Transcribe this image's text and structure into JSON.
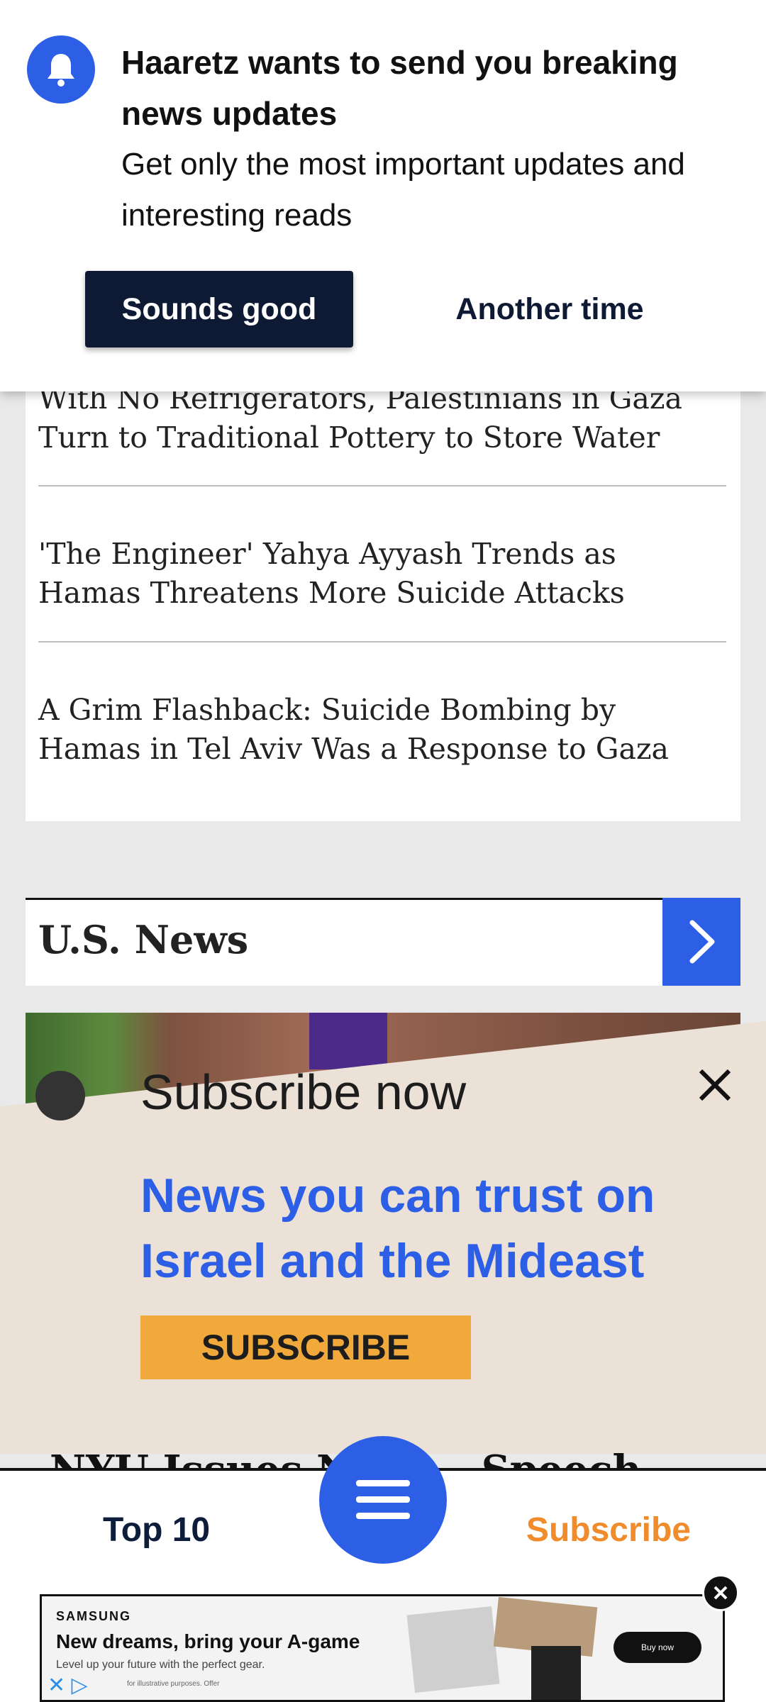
{
  "notification_prompt": {
    "title": "Haaretz wants to send you breaking news updates",
    "body": "Get only the most important updates and interesting reads",
    "accept_label": "Sounds good",
    "decline_label": "Another time",
    "icon": "bell-icon"
  },
  "articles": [
    {
      "title": "With No Refrigerators, Palestinians in Gaza Turn to Traditional Pottery to Store Water"
    },
    {
      "title": "'The Engineer' Yahya Ayyash Trends as Hamas Threatens More Suicide Attacks"
    },
    {
      "title": "A Grim Flashback: Suicide Bombing by Hamas in Tel Aviv Was a Response to Gaza"
    }
  ],
  "section": {
    "title": "U.S. News",
    "arrow_icon": "chevron-right-icon"
  },
  "subscribe_banner": {
    "heading": "Subscribe now",
    "headline": "News you can trust on Israel and the Mideast",
    "button_label": "SUBSCRIBE",
    "close_icon": "close-icon"
  },
  "peek_headline": "NYU Issues New ... Speech",
  "bottom_nav": {
    "top10_label": "Top 10",
    "subscribe_label": "Subscribe",
    "menu_icon": "hamburger-menu-icon"
  },
  "ad": {
    "brand": "SAMSUNG",
    "headline": "New dreams, bring your A-game",
    "subtext": "Level up your future with the perfect gear.",
    "disclaimer": "for illustrative purposes. Offer",
    "cta": "Buy now"
  },
  "colors": {
    "accent_blue": "#2c5fe6",
    "navy": "#0e1a33",
    "subscribe_orange": "#f08c2c",
    "subscribe_button": "#f1a93b",
    "banner_bg": "#ebe1d6"
  }
}
